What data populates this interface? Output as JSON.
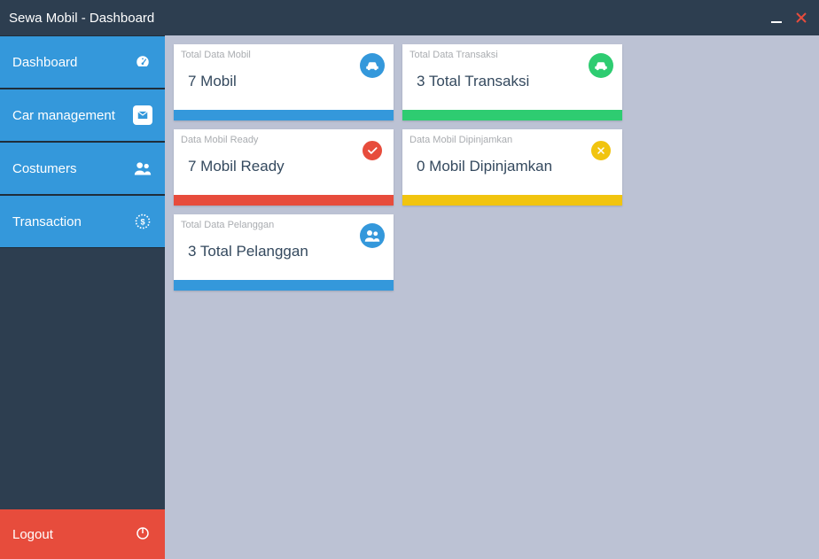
{
  "window": {
    "title": "Sewa Mobil - Dashboard"
  },
  "sidebar": {
    "items": [
      {
        "label": "Dashboard"
      },
      {
        "label": "Car management"
      },
      {
        "label": "Costumers"
      },
      {
        "label": "Transaction"
      }
    ],
    "logout": "Logout"
  },
  "cards": {
    "mobil": {
      "title": "Total Data Mobil",
      "value": "7 Mobil"
    },
    "transaksi": {
      "title": "Total Data Transaksi",
      "value": "3 Total Transaksi"
    },
    "ready": {
      "title": "Data Mobil Ready",
      "value": "7 Mobil Ready"
    },
    "pinjam": {
      "title": "Data Mobil Dipinjamkan",
      "value": "0 Mobil Dipinjamkan"
    },
    "pelanggan": {
      "title": "Total Data Pelanggan",
      "value": "3 Total Pelanggan"
    }
  },
  "colors": {
    "blue": "#3498db",
    "green": "#2ecc71",
    "red": "#e74c3c",
    "yellow": "#f1c40f"
  }
}
